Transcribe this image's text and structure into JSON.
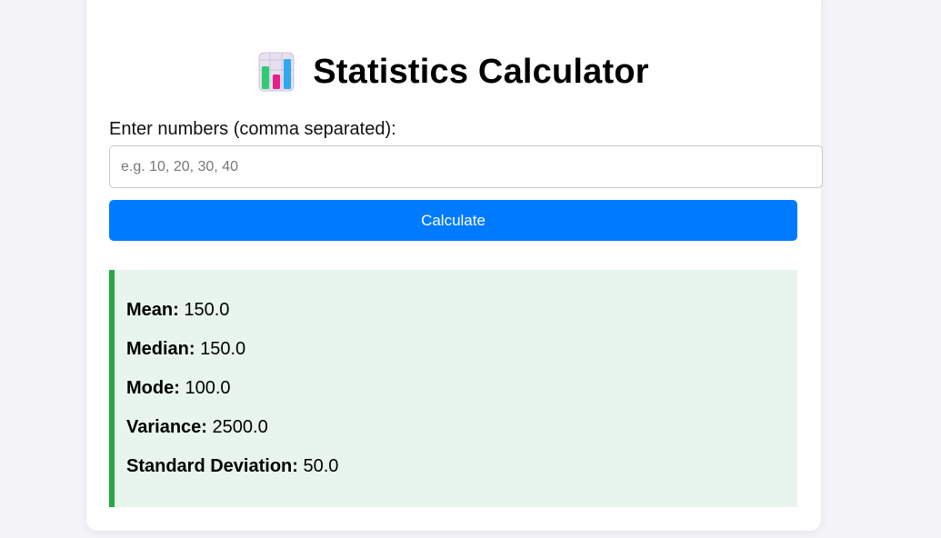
{
  "header": {
    "icon": "bar-chart-icon",
    "title": "Statistics Calculator"
  },
  "form": {
    "label": "Enter numbers (comma separated):",
    "input_value": "",
    "input_placeholder": "e.g. 10, 20, 30, 40",
    "button_label": "Calculate"
  },
  "results": {
    "mean_label": "Mean:",
    "mean_value": "150.0",
    "median_label": "Median:",
    "median_value": "150.0",
    "mode_label": "Mode:",
    "mode_value": "100.0",
    "variance_label": "Variance:",
    "variance_value": "2500.0",
    "std_label": "Standard Deviation:",
    "std_value": "50.0"
  },
  "colors": {
    "button": "#007bff",
    "result_border": "#28a745",
    "result_bg": "#e8f5ec",
    "page_bg": "#f3f3f8"
  }
}
